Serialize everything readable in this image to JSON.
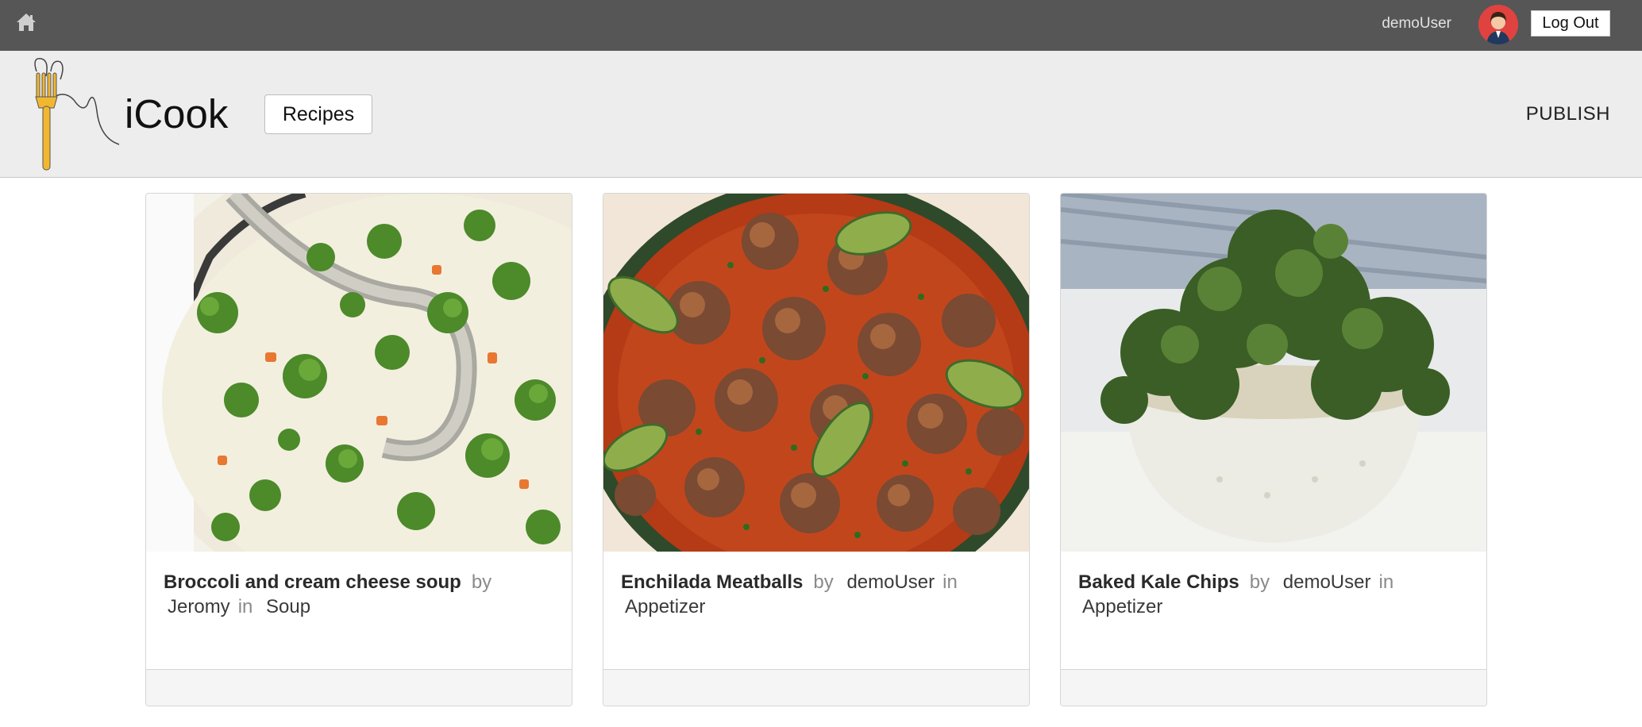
{
  "topbar": {
    "home_icon": "home-icon",
    "username": "demoUser",
    "avatar_icon": "user-avatar",
    "logout_label": "Log Out"
  },
  "header": {
    "brand": "iCook",
    "logo_icon": "fork-logo-icon",
    "recipes_label": "Recipes",
    "publish_label": "PUBLISH"
  },
  "recipes": [
    {
      "title": "Broccoli and cream cheese soup",
      "by": "by",
      "author": "Jeromy",
      "in": "in",
      "category": "Soup",
      "image": "broccoli-soup-photo"
    },
    {
      "title": "Enchilada Meatballs",
      "by": "by",
      "author": "demoUser",
      "in": "in",
      "category": "Appetizer",
      "image": "enchilada-meatballs-photo"
    },
    {
      "title": "Baked Kale Chips",
      "by": "by",
      "author": "demoUser",
      "in": "in",
      "category": "Appetizer",
      "image": "kale-chips-photo"
    }
  ],
  "colors": {
    "topbar": "#565656",
    "header": "#ededed",
    "logo_fork": "#f2b731"
  }
}
